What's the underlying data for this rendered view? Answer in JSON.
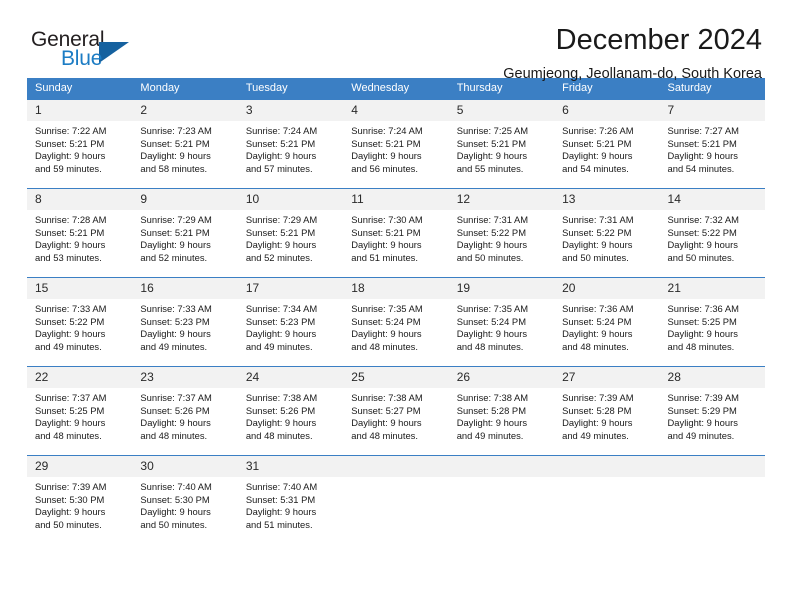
{
  "brand": {
    "name_top": "General",
    "name_bottom": "Blue",
    "triangle_icon": "blue-triangle-logo-mark",
    "color_dark": "#231f20",
    "color_blue": "#1c7cc4"
  },
  "header": {
    "title": "December 2024",
    "location": "Geumjeong, Jeollanam-do, South Korea"
  },
  "theme": {
    "header_row_bg": "#3b7fc4",
    "daynum_bg": "#f2f2f2",
    "page_bg": "#ffffff"
  },
  "weekdays": [
    "Sunday",
    "Monday",
    "Tuesday",
    "Wednesday",
    "Thursday",
    "Friday",
    "Saturday"
  ],
  "weeks": [
    [
      {
        "day": "1",
        "sunrise": "Sunrise: 7:22 AM",
        "sunset": "Sunset: 5:21 PM",
        "daylight1": "Daylight: 9 hours",
        "daylight2": "and 59 minutes."
      },
      {
        "day": "2",
        "sunrise": "Sunrise: 7:23 AM",
        "sunset": "Sunset: 5:21 PM",
        "daylight1": "Daylight: 9 hours",
        "daylight2": "and 58 minutes."
      },
      {
        "day": "3",
        "sunrise": "Sunrise: 7:24 AM",
        "sunset": "Sunset: 5:21 PM",
        "daylight1": "Daylight: 9 hours",
        "daylight2": "and 57 minutes."
      },
      {
        "day": "4",
        "sunrise": "Sunrise: 7:24 AM",
        "sunset": "Sunset: 5:21 PM",
        "daylight1": "Daylight: 9 hours",
        "daylight2": "and 56 minutes."
      },
      {
        "day": "5",
        "sunrise": "Sunrise: 7:25 AM",
        "sunset": "Sunset: 5:21 PM",
        "daylight1": "Daylight: 9 hours",
        "daylight2": "and 55 minutes."
      },
      {
        "day": "6",
        "sunrise": "Sunrise: 7:26 AM",
        "sunset": "Sunset: 5:21 PM",
        "daylight1": "Daylight: 9 hours",
        "daylight2": "and 54 minutes."
      },
      {
        "day": "7",
        "sunrise": "Sunrise: 7:27 AM",
        "sunset": "Sunset: 5:21 PM",
        "daylight1": "Daylight: 9 hours",
        "daylight2": "and 54 minutes."
      }
    ],
    [
      {
        "day": "8",
        "sunrise": "Sunrise: 7:28 AM",
        "sunset": "Sunset: 5:21 PM",
        "daylight1": "Daylight: 9 hours",
        "daylight2": "and 53 minutes."
      },
      {
        "day": "9",
        "sunrise": "Sunrise: 7:29 AM",
        "sunset": "Sunset: 5:21 PM",
        "daylight1": "Daylight: 9 hours",
        "daylight2": "and 52 minutes."
      },
      {
        "day": "10",
        "sunrise": "Sunrise: 7:29 AM",
        "sunset": "Sunset: 5:21 PM",
        "daylight1": "Daylight: 9 hours",
        "daylight2": "and 52 minutes."
      },
      {
        "day": "11",
        "sunrise": "Sunrise: 7:30 AM",
        "sunset": "Sunset: 5:21 PM",
        "daylight1": "Daylight: 9 hours",
        "daylight2": "and 51 minutes."
      },
      {
        "day": "12",
        "sunrise": "Sunrise: 7:31 AM",
        "sunset": "Sunset: 5:22 PM",
        "daylight1": "Daylight: 9 hours",
        "daylight2": "and 50 minutes."
      },
      {
        "day": "13",
        "sunrise": "Sunrise: 7:31 AM",
        "sunset": "Sunset: 5:22 PM",
        "daylight1": "Daylight: 9 hours",
        "daylight2": "and 50 minutes."
      },
      {
        "day": "14",
        "sunrise": "Sunrise: 7:32 AM",
        "sunset": "Sunset: 5:22 PM",
        "daylight1": "Daylight: 9 hours",
        "daylight2": "and 50 minutes."
      }
    ],
    [
      {
        "day": "15",
        "sunrise": "Sunrise: 7:33 AM",
        "sunset": "Sunset: 5:22 PM",
        "daylight1": "Daylight: 9 hours",
        "daylight2": "and 49 minutes."
      },
      {
        "day": "16",
        "sunrise": "Sunrise: 7:33 AM",
        "sunset": "Sunset: 5:23 PM",
        "daylight1": "Daylight: 9 hours",
        "daylight2": "and 49 minutes."
      },
      {
        "day": "17",
        "sunrise": "Sunrise: 7:34 AM",
        "sunset": "Sunset: 5:23 PM",
        "daylight1": "Daylight: 9 hours",
        "daylight2": "and 49 minutes."
      },
      {
        "day": "18",
        "sunrise": "Sunrise: 7:35 AM",
        "sunset": "Sunset: 5:24 PM",
        "daylight1": "Daylight: 9 hours",
        "daylight2": "and 48 minutes."
      },
      {
        "day": "19",
        "sunrise": "Sunrise: 7:35 AM",
        "sunset": "Sunset: 5:24 PM",
        "daylight1": "Daylight: 9 hours",
        "daylight2": "and 48 minutes."
      },
      {
        "day": "20",
        "sunrise": "Sunrise: 7:36 AM",
        "sunset": "Sunset: 5:24 PM",
        "daylight1": "Daylight: 9 hours",
        "daylight2": "and 48 minutes."
      },
      {
        "day": "21",
        "sunrise": "Sunrise: 7:36 AM",
        "sunset": "Sunset: 5:25 PM",
        "daylight1": "Daylight: 9 hours",
        "daylight2": "and 48 minutes."
      }
    ],
    [
      {
        "day": "22",
        "sunrise": "Sunrise: 7:37 AM",
        "sunset": "Sunset: 5:25 PM",
        "daylight1": "Daylight: 9 hours",
        "daylight2": "and 48 minutes."
      },
      {
        "day": "23",
        "sunrise": "Sunrise: 7:37 AM",
        "sunset": "Sunset: 5:26 PM",
        "daylight1": "Daylight: 9 hours",
        "daylight2": "and 48 minutes."
      },
      {
        "day": "24",
        "sunrise": "Sunrise: 7:38 AM",
        "sunset": "Sunset: 5:26 PM",
        "daylight1": "Daylight: 9 hours",
        "daylight2": "and 48 minutes."
      },
      {
        "day": "25",
        "sunrise": "Sunrise: 7:38 AM",
        "sunset": "Sunset: 5:27 PM",
        "daylight1": "Daylight: 9 hours",
        "daylight2": "and 48 minutes."
      },
      {
        "day": "26",
        "sunrise": "Sunrise: 7:38 AM",
        "sunset": "Sunset: 5:28 PM",
        "daylight1": "Daylight: 9 hours",
        "daylight2": "and 49 minutes."
      },
      {
        "day": "27",
        "sunrise": "Sunrise: 7:39 AM",
        "sunset": "Sunset: 5:28 PM",
        "daylight1": "Daylight: 9 hours",
        "daylight2": "and 49 minutes."
      },
      {
        "day": "28",
        "sunrise": "Sunrise: 7:39 AM",
        "sunset": "Sunset: 5:29 PM",
        "daylight1": "Daylight: 9 hours",
        "daylight2": "and 49 minutes."
      }
    ],
    [
      {
        "day": "29",
        "sunrise": "Sunrise: 7:39 AM",
        "sunset": "Sunset: 5:30 PM",
        "daylight1": "Daylight: 9 hours",
        "daylight2": "and 50 minutes."
      },
      {
        "day": "30",
        "sunrise": "Sunrise: 7:40 AM",
        "sunset": "Sunset: 5:30 PM",
        "daylight1": "Daylight: 9 hours",
        "daylight2": "and 50 minutes."
      },
      {
        "day": "31",
        "sunrise": "Sunrise: 7:40 AM",
        "sunset": "Sunset: 5:31 PM",
        "daylight1": "Daylight: 9 hours",
        "daylight2": "and 51 minutes."
      },
      {
        "day": "",
        "sunrise": "",
        "sunset": "",
        "daylight1": "",
        "daylight2": ""
      },
      {
        "day": "",
        "sunrise": "",
        "sunset": "",
        "daylight1": "",
        "daylight2": ""
      },
      {
        "day": "",
        "sunrise": "",
        "sunset": "",
        "daylight1": "",
        "daylight2": ""
      },
      {
        "day": "",
        "sunrise": "",
        "sunset": "",
        "daylight1": "",
        "daylight2": ""
      }
    ]
  ]
}
